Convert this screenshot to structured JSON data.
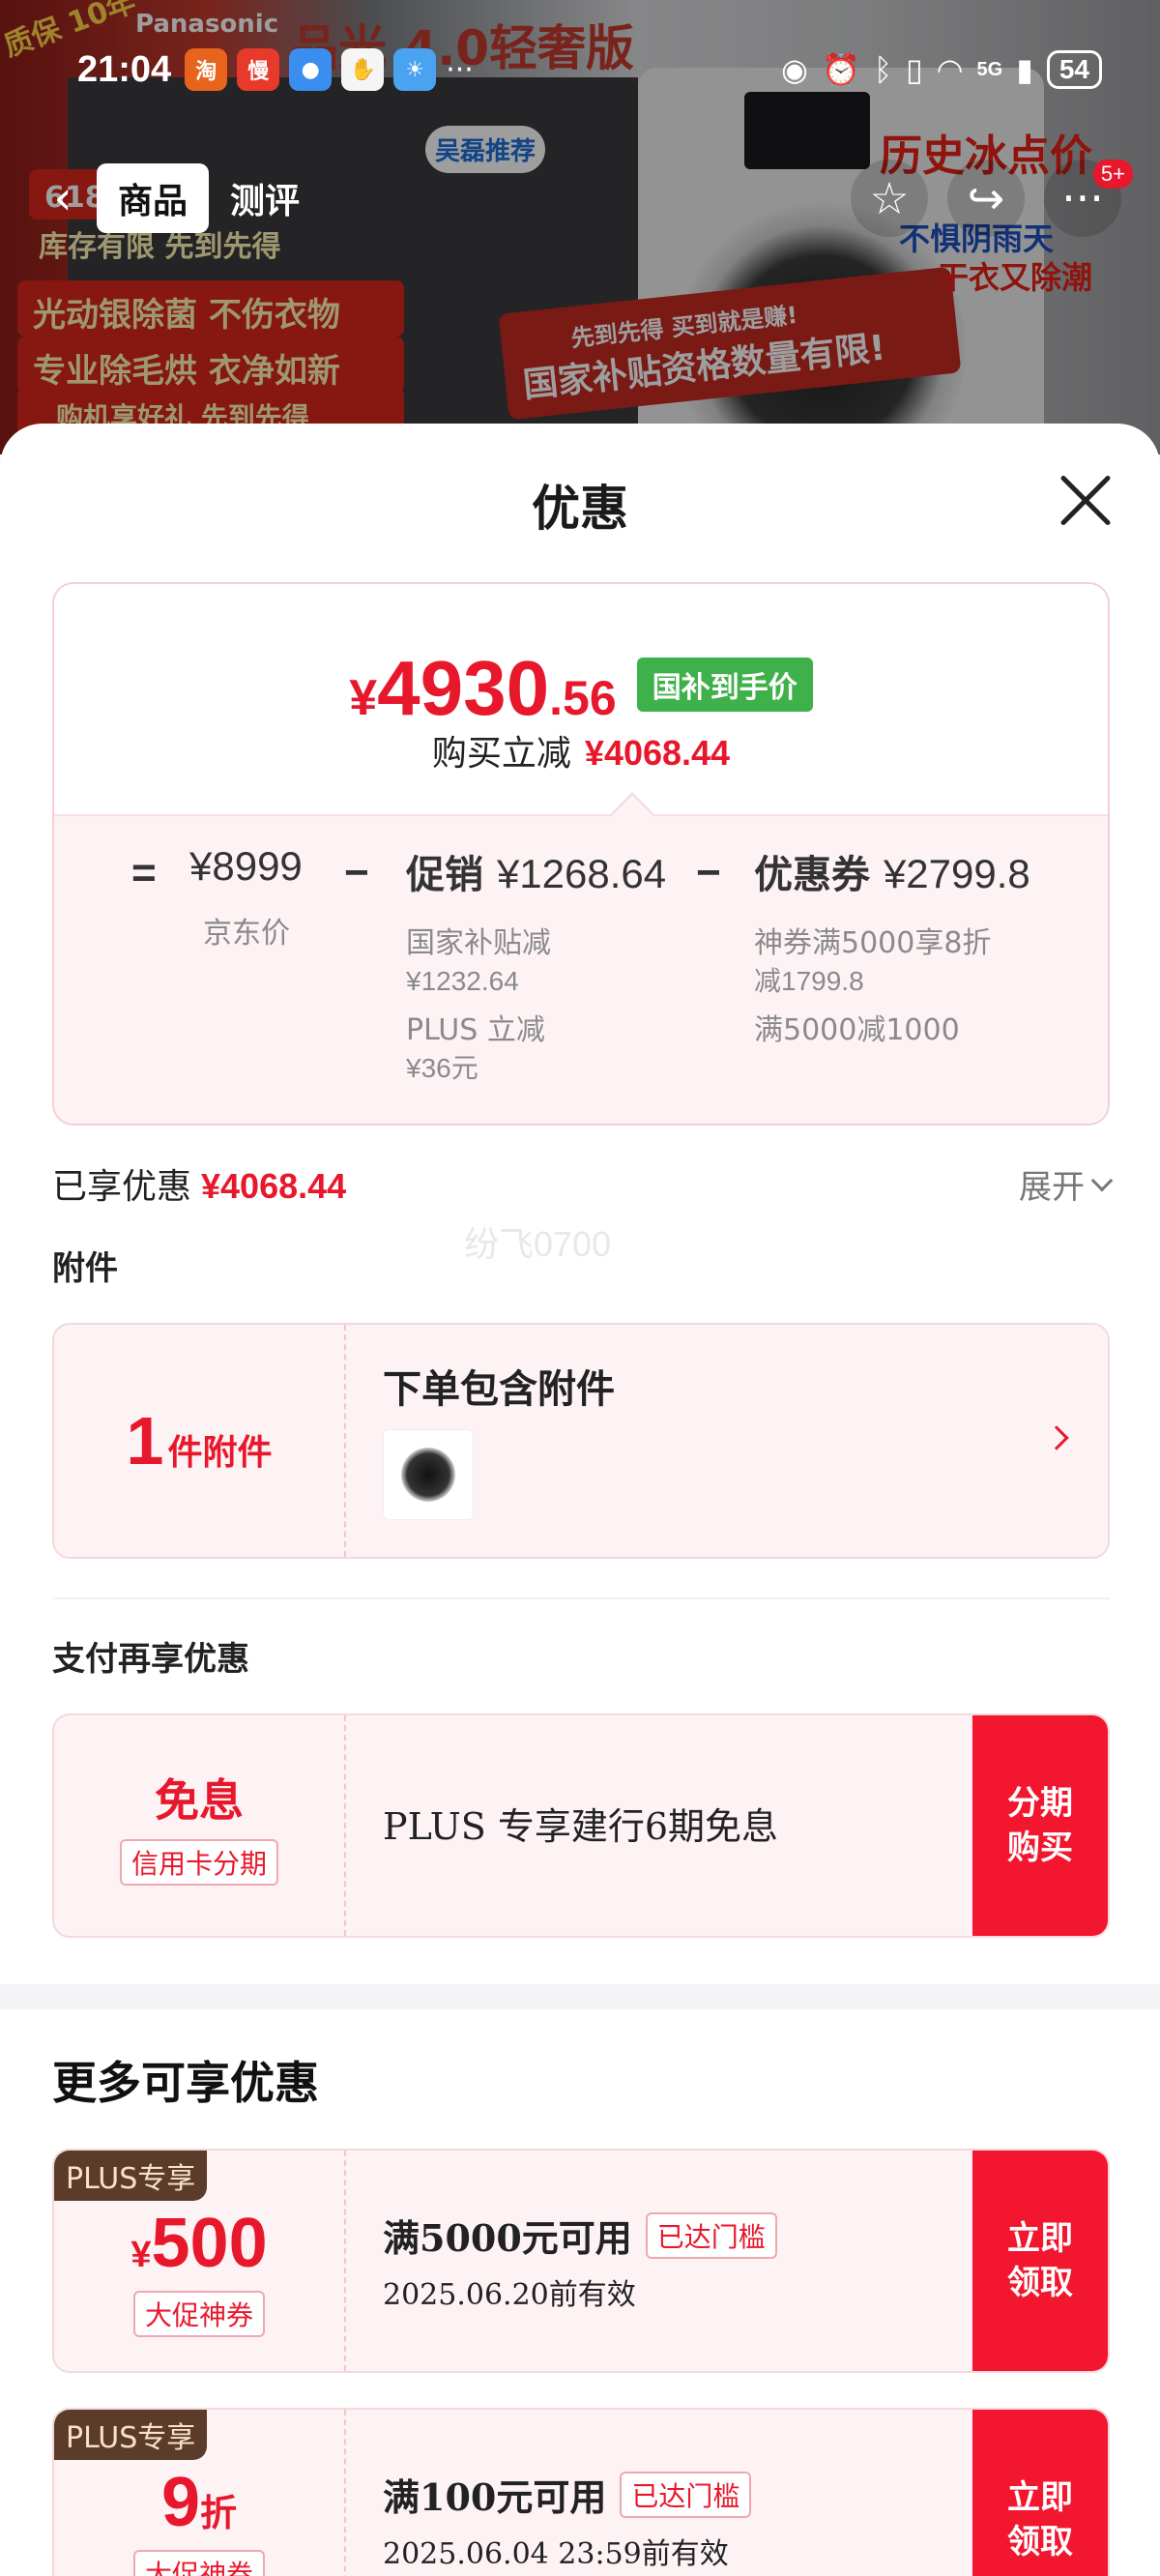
{
  "status_bar": {
    "time": "21:04",
    "network": "5G",
    "battery": "54",
    "more": "···"
  },
  "background": {
    "texts": {
      "brand": "Panasonic",
      "warranty": "质保 10年",
      "version": "品光 4.0轻奢版",
      "recommend": "吴磊推荐",
      "stock": "库存有限 先到先得",
      "slogan1": "光动银除菌 不伤衣物",
      "slogan2": "专业除毛烘 衣净如新",
      "slogan3": "购机享好礼 先到先得",
      "ribbon1": "先到先得 买到就是赚!",
      "ribbon2": "国家补贴资格数量有限!",
      "history_price": "历史冰点价",
      "weather1": "不惧阴雨天",
      "weather2": "干衣又除潮",
      "promo_partial": "618狂欢"
    }
  },
  "nav": {
    "tabs": [
      {
        "label": "商品",
        "active": true
      },
      {
        "label": "测评",
        "active": false
      }
    ],
    "cart_badge": "5+"
  },
  "sheet": {
    "title": "优惠"
  },
  "price_card": {
    "symbol": "¥",
    "integer": "4930",
    "decimal": ".56",
    "tag": "国补到手价",
    "reduce_label": "购买立减",
    "reduce_value": "¥4068.44",
    "equation": {
      "equals": "=",
      "minus": "−",
      "base": {
        "value": "¥8999",
        "label": "京东价"
      },
      "promo": {
        "prefix": "促销",
        "value": "¥1268.64",
        "lines": [
          {
            "label": "国家补贴减",
            "value": "¥1232.64"
          },
          {
            "label": "PLUS 立减",
            "value": "¥36元"
          }
        ]
      },
      "coupon": {
        "prefix": "优惠券",
        "value": "¥2799.8",
        "lines": [
          {
            "label": "神券满5000享8折",
            "value": "减1799.8"
          },
          {
            "label": "满5000减1000",
            "value": ""
          }
        ]
      }
    }
  },
  "enjoyed": {
    "label": "已享优惠",
    "value": "¥4068.44",
    "expand": "展开"
  },
  "watermark": "纷飞0700",
  "accessories": {
    "section_label": "附件",
    "count": "1",
    "unit": "件附件",
    "title": "下单包含附件"
  },
  "payment": {
    "section_label": "支付再享优惠",
    "left_title": "免息",
    "left_tag": "信用卡分期",
    "desc": "PLUS 专享建行6期免息",
    "button": [
      "分期",
      "购买"
    ]
  },
  "more_offers": {
    "title": "更多可享优惠",
    "coupons": [
      {
        "plus_tag": "PLUS专享",
        "symbol": "¥",
        "amount": "500",
        "amount_suffix": "",
        "tag": "大促神券",
        "condition": "满5000元可用",
        "status": "已达门槛",
        "valid": "2025.06.20前有效",
        "button": [
          "立即",
          "领取"
        ]
      },
      {
        "plus_tag": "PLUS专享",
        "symbol": "",
        "amount": "9",
        "amount_suffix": "折",
        "tag": "大促神券",
        "condition": "满100元可用",
        "status": "已达门槛",
        "valid": "2025.06.04 23:59前有效",
        "button": [
          "立即",
          "领取"
        ]
      }
    ]
  },
  "colors": {
    "accent": "#e8182c",
    "button": "#f2162f",
    "tag_green": "#3fb14a",
    "card_bg": "#fdf3f4",
    "plus_tag_bg": "#5b3c2a"
  }
}
